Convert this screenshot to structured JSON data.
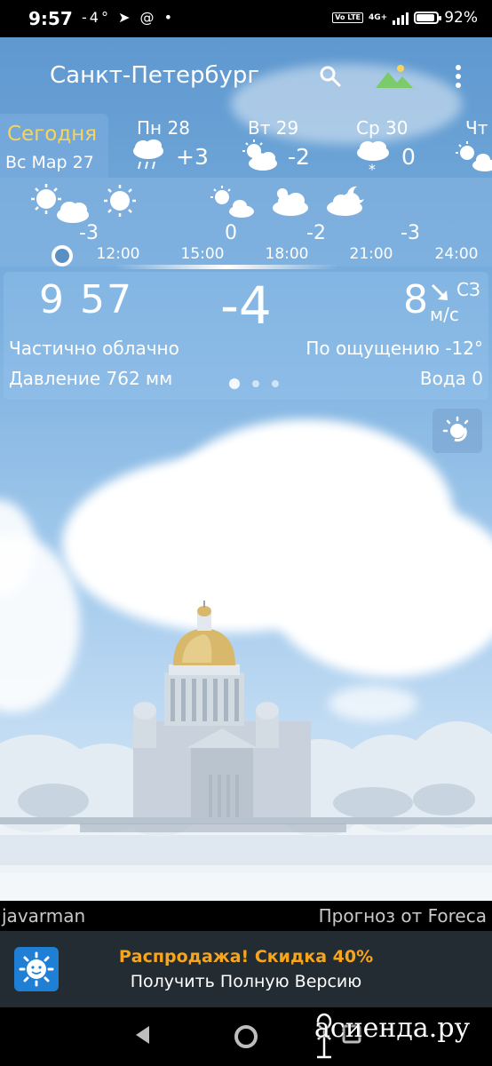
{
  "status_bar": {
    "time": "9:57",
    "left_icons": "-4° ➤ @ •",
    "network": "Vo LTE",
    "network_type": "4G+",
    "battery_percent": "92%",
    "battery_level": 0.92
  },
  "header": {
    "city": "Санкт-Петербург"
  },
  "days": {
    "today_label": "Сегодня",
    "today_date": "Вс Мар 27",
    "items": [
      {
        "name": "Пн 28",
        "temp": "+3",
        "icon": "rain-cloud-icon"
      },
      {
        "name": "Вт 29",
        "temp": "-2",
        "icon": "partly-cloudy-icon"
      },
      {
        "name": "Ср 30",
        "temp": "0",
        "icon": "snow-cloud-icon"
      },
      {
        "name": "Чт",
        "temp": "",
        "icon": "partly-cloudy-icon"
      }
    ]
  },
  "hourly": {
    "temps": [
      "-3",
      "0",
      "-2",
      "-3"
    ],
    "times": [
      "12:00",
      "15:00",
      "18:00",
      "21:00",
      "24:00"
    ]
  },
  "current": {
    "time_hours": "9",
    "time_minutes": "57",
    "temperature": "-4",
    "wind_speed": "8",
    "wind_direction": "СЗ",
    "wind_unit": "м/с",
    "condition": "Частично облачно",
    "feels_like": "По ощущению -12°",
    "pressure": "Давление 762 мм",
    "water": "Вода 0"
  },
  "footer": {
    "photo_author": "javarman",
    "forecast_credit": "Прогноз от Foreca",
    "promo_title": "Распродажа! Скидка 40%",
    "promo_subtitle": "Получить Полную Версию",
    "watermark": "асиенда.ру"
  },
  "colors": {
    "today_label": "#f7d55a",
    "promo_title": "#f7a51b",
    "promo_background": "#242c33",
    "sky": "#7eb2e0"
  }
}
